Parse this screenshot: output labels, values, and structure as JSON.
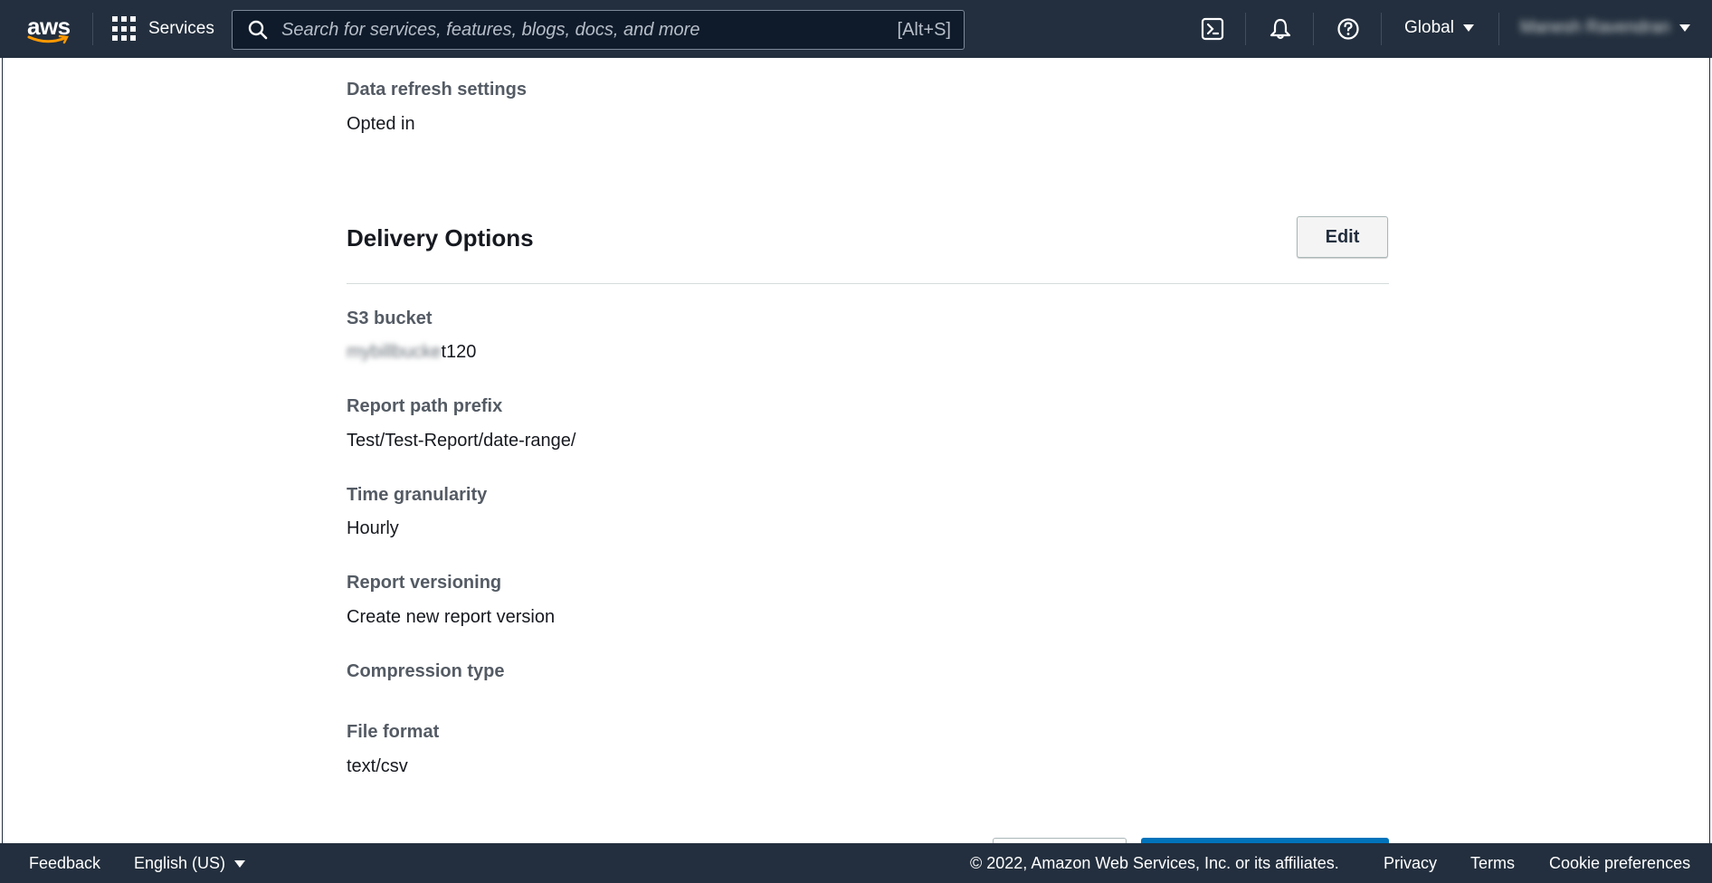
{
  "header": {
    "logo_text": "aws",
    "services_label": "Services",
    "search_placeholder": "Search for services, features, blogs, docs, and more",
    "search_shortcut": "[Alt+S]",
    "region_label": "Global",
    "account_name": "Manesh Ravendran"
  },
  "top_field": {
    "label": "Data refresh settings",
    "value": "Opted in"
  },
  "delivery": {
    "title": "Delivery Options",
    "edit_label": "Edit",
    "fields": [
      {
        "label": "S3 bucket",
        "value_blurred": "mybillbucke",
        "value": "t120"
      },
      {
        "label": "Report path prefix",
        "value": "Test/Test-Report/date-range/"
      },
      {
        "label": "Time granularity",
        "value": "Hourly"
      },
      {
        "label": "Report versioning",
        "value": "Create new report version"
      },
      {
        "label": "Compression type",
        "value": ""
      },
      {
        "label": "File format",
        "value": "text/csv"
      }
    ]
  },
  "footer": {
    "feedback": "Feedback",
    "language": "English (US)",
    "copyright": "© 2022, Amazon Web Services, Inc. or its affiliates.",
    "privacy": "Privacy",
    "terms": "Terms",
    "cookies": "Cookie preferences"
  },
  "colors": {
    "nav_bg": "#232f3e",
    "aws_smile": "#ff9900",
    "label": "#545b64",
    "text": "#16191f",
    "primary": "#0073bb"
  }
}
